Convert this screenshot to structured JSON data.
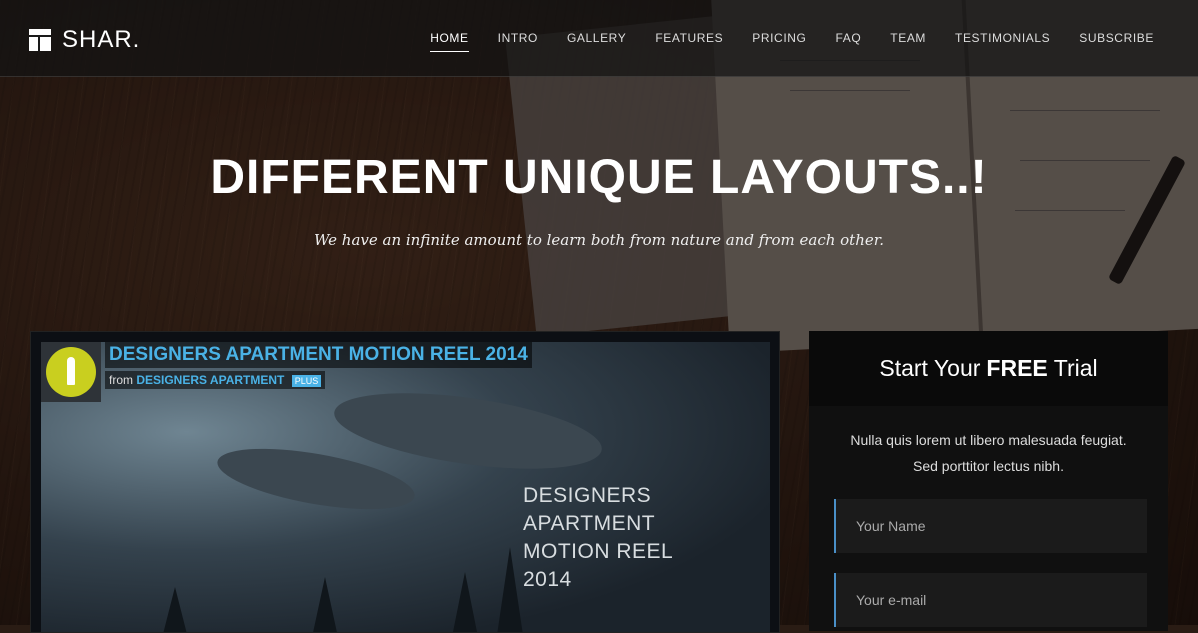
{
  "brand": {
    "name": "SHAR."
  },
  "nav": {
    "items": [
      {
        "label": "HOME"
      },
      {
        "label": "INTRO"
      },
      {
        "label": "GALLERY"
      },
      {
        "label": "FEATURES"
      },
      {
        "label": "PRICING"
      },
      {
        "label": "FAQ"
      },
      {
        "label": "TEAM"
      },
      {
        "label": "TESTIMONIALS"
      },
      {
        "label": "SUBSCRIBE"
      }
    ],
    "active": "HOME"
  },
  "hero": {
    "title": "DIFFERENT UNIQUE LAYOUTS..!",
    "subtitle": "We have an infinite amount to learn both from nature and from each other."
  },
  "video": {
    "title": "DESIGNERS APARTMENT MOTION REEL 2014",
    "from_label": "from",
    "from_author": "DESIGNERS APARTMENT",
    "tag": "PLUS",
    "poster_lines": [
      "DESIGNERS",
      "APARTMENT",
      "MOTION REEL",
      "2014"
    ]
  },
  "trial": {
    "title_start": "Start Your",
    "title_bold": "FREE",
    "title_end": "Trial",
    "text_line1": "Nulla quis lorem ut libero malesuada feugiat.",
    "text_line2": "Sed porttitor lectus nibh.",
    "name_placeholder": "Your Name",
    "email_placeholder": "Your e-mail"
  }
}
